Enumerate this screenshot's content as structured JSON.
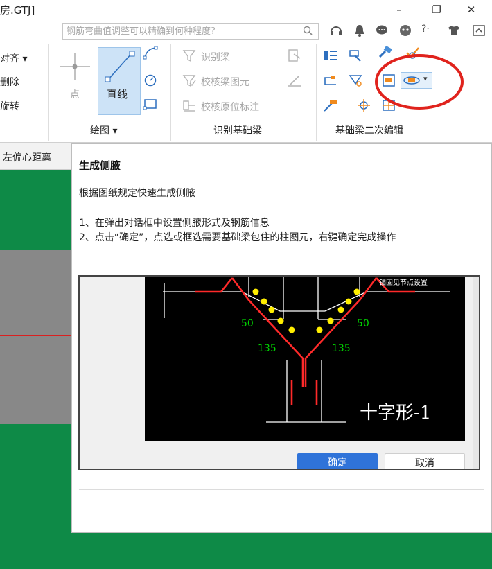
{
  "window": {
    "title": "房.GTJ]",
    "minimize": "–",
    "restore": "❐",
    "close": "✕"
  },
  "search": {
    "placeholder": "钢筋弯曲值调整可以精确到何种程度?"
  },
  "ribbon": {
    "left_items": [
      "对齐 ▾",
      "删除",
      "旋转"
    ],
    "draw_group": {
      "point_label": "点",
      "line_label": "直线",
      "group_label": "绘图 ▾"
    },
    "identify_group": {
      "items": [
        "识别梁",
        "校核梁图元",
        "校核原位标注"
      ],
      "group_label": "识别基础梁"
    },
    "edit2_group": {
      "group_label": "基础梁二次编辑"
    }
  },
  "left_panel": {
    "tab_label": "左偏心距离"
  },
  "tooltip": {
    "title": "生成侧腋",
    "description": "根据图纸规定快速生成侧腋",
    "steps": [
      "1、在弹出对话框中设置侧腋形式及钢筋信息",
      "2、点击“确定”，点选或框选需要基础梁包住的柱图元，右键确定完成操作"
    ],
    "preview": {
      "header_text": "锚固见节点设置",
      "angle_left": "50",
      "angle_right": "50",
      "hook_left": "135",
      "hook_right": "135",
      "shape_label": "十字形-1",
      "ok_button": "确定",
      "cancel_button": "取消"
    }
  },
  "colors": {
    "canvas_green": "#0e8a47",
    "highlight_red": "#e0231d",
    "rebar_red": "#ff2a2a",
    "rebar_yellow": "#ffee00",
    "dim_green": "#00d400",
    "ok_blue": "#2f73d9"
  }
}
